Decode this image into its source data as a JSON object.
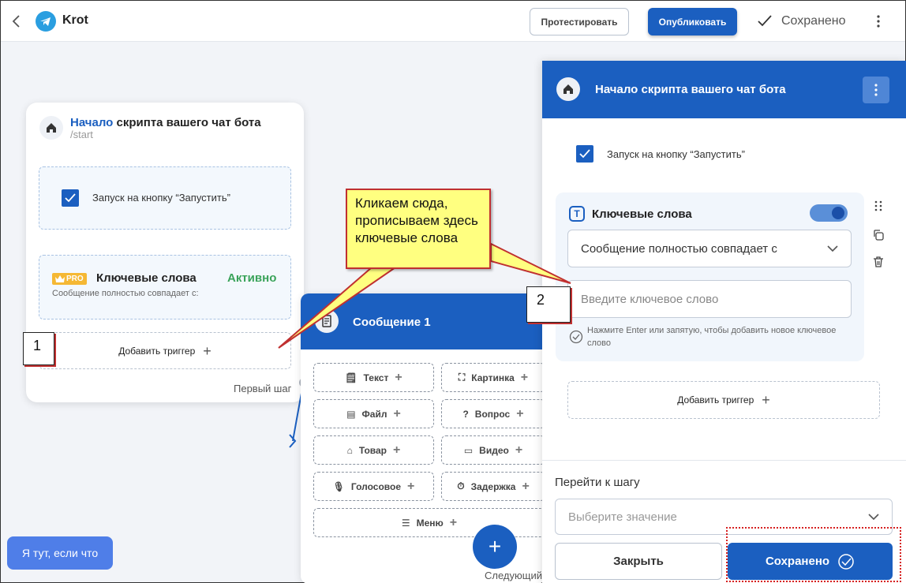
{
  "topbar": {
    "app_title": "Krot",
    "test_button": "Протестировать",
    "publish_button": "Опубликовать",
    "saved_status": "Сохранено"
  },
  "start_card": {
    "title_accent": "Начало",
    "title_rest": " скрипта вашего чат бота",
    "command": "/start",
    "start_checkbox_label": "Запуск на кнопку “Запустить”",
    "pro_badge": "PRO",
    "keywords_title": "Ключевые слова",
    "keywords_status": "Активно",
    "keywords_desc": "Сообщение полностью совпадает с:",
    "add_trigger": "Добавить триггер",
    "first_step": "Первый шаг"
  },
  "message_card": {
    "title": "Сообщение 1",
    "items": {
      "text": "Текст",
      "image": "Картинка",
      "file": "Файл",
      "question": "Вопрос",
      "product": "Товар",
      "video": "Видео",
      "voice": "Голосовое",
      "delay": "Задержка",
      "menu": "Меню"
    },
    "next_label": "Следующий"
  },
  "panel": {
    "title": "Начало скрипта вашего чат бота",
    "start_checkbox_label": "Запуск на кнопку “Запустить”",
    "keywords_title": "Ключевые слова",
    "match_mode": "Сообщение полностью совпадает с",
    "keyword_placeholder": "Введите ключевое слово",
    "hint": "Нажмите Enter или запятую, чтобы добавить новое ключевое слово",
    "add_trigger": "Добавить триггер",
    "goto_label": "Перейти к шагу",
    "goto_placeholder": "Выберите значение",
    "close_button": "Закрыть",
    "saved_button": "Сохранено"
  },
  "help_button": "Я тут, если что",
  "annotations": {
    "marker_1": "1",
    "marker_2": "2",
    "callout": "Кликаем сюда, прописываем здесь ключевые слова"
  },
  "colors": {
    "primary": "#1b5fc0",
    "active_green": "#3aa35a",
    "callout_bg": "#ffff80",
    "annotation_red": "#c03030"
  }
}
